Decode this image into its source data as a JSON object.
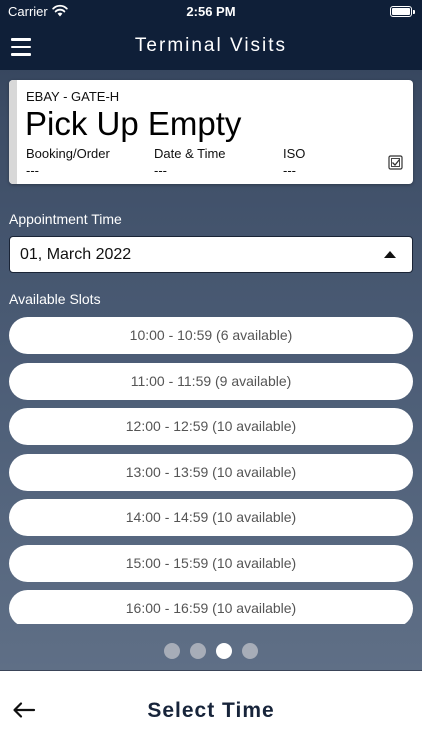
{
  "status_bar": {
    "carrier": "Carrier",
    "time": "2:56 PM",
    "wifi_icon": "wifi-icon",
    "battery_icon": "battery-icon"
  },
  "nav": {
    "title": "Terminal Visits",
    "menu_icon": "hamburger-menu-icon"
  },
  "visit_card": {
    "location": "EBAY - GATE-H",
    "title": "Pick Up Empty",
    "fields": [
      {
        "label": "Booking/Order",
        "value": "---"
      },
      {
        "label": "Date & Time",
        "value": "---"
      },
      {
        "label": "ISO",
        "value": "---"
      }
    ],
    "action_icon": "checkbox-edit-icon"
  },
  "appointment": {
    "label": "Appointment Time",
    "selected_date": "01, March 2022"
  },
  "slots": {
    "label": "Available Slots",
    "items": [
      "10:00 - 10:59 (6 available)",
      "11:00 - 11:59 (9 available)",
      "12:00 - 12:59 (10 available)",
      "13:00 - 13:59 (10 available)",
      "14:00 - 14:59 (10 available)",
      "15:00 - 15:59 (10 available)",
      "16:00 - 16:59 (10 available)"
    ]
  },
  "pager": {
    "total": 4,
    "active_index": 2
  },
  "bottom": {
    "title": "Select Time",
    "back_icon": "arrow-left-icon"
  },
  "colors": {
    "nav_bg": "#0f1f38",
    "accent_dark": "#17243a",
    "dot_inactive": "#a7adb8",
    "dot_active": "#ffffff"
  }
}
